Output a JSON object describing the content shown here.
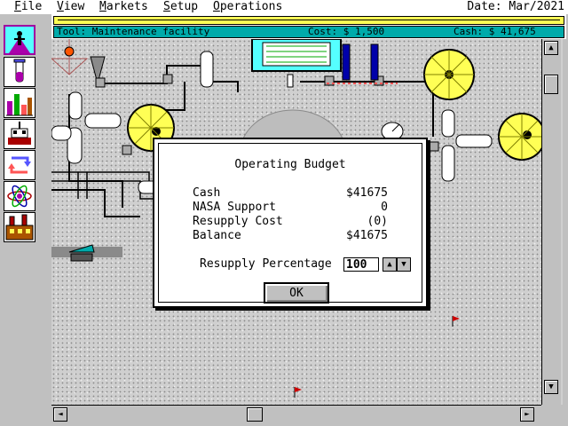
{
  "menu": {
    "items": [
      {
        "hot": "F",
        "rest": "ile"
      },
      {
        "hot": "V",
        "rest": "iew"
      },
      {
        "hot": "M",
        "rest": "arkets"
      },
      {
        "hot": "S",
        "rest": "etup"
      },
      {
        "hot": "O",
        "rest": "perations"
      }
    ],
    "date": "Date: Mar/2021"
  },
  "status": {
    "tool": "Tool: Maintenance facility",
    "cost": "Cost: $ 1,500",
    "cash": "Cash: $ 41,675"
  },
  "palette": {
    "tools": [
      {
        "icon": "colonist-icon"
      },
      {
        "icon": "test-tube-icon"
      },
      {
        "icon": "bar-chart-icon"
      },
      {
        "icon": "landing-pad-icon"
      },
      {
        "icon": "recycle-arrows-icon"
      },
      {
        "icon": "atom-icon"
      },
      {
        "icon": "factory-icon"
      }
    ],
    "selected": 0
  },
  "dialog": {
    "title": "Operating Budget",
    "rows": [
      {
        "label": "Cash",
        "value": "$41675"
      },
      {
        "label": "NASA Support",
        "value": "0"
      },
      {
        "label": "Resupply Cost",
        "value": "(0)"
      },
      {
        "label": "Balance",
        "value": "$41675"
      }
    ],
    "resupply_label": "Resupply Percentage",
    "resupply_value": "100",
    "up_arrow": "▲",
    "down_arrow": "▼",
    "ok_label": "OK"
  },
  "scroll": {
    "up": "▲",
    "down": "▼",
    "left": "◄",
    "right": "►"
  },
  "colors": {
    "status_bg": "#00aaaa",
    "message_bg": "#ffff55",
    "dome_yellow": "#ffff55",
    "greenhouse_cyan": "#55ffff",
    "tank_blue": "#0000aa",
    "flag_red": "#cc0000",
    "selected_tool_border": "#a000a0"
  }
}
